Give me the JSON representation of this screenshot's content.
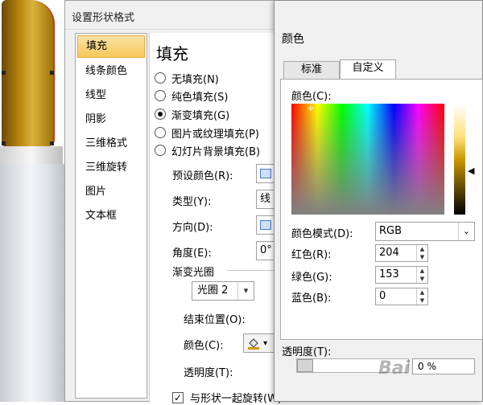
{
  "format_dialog": {
    "title": "设置形状格式",
    "help": "?",
    "sidebar": [
      "填充",
      "线条颜色",
      "线型",
      "阴影",
      "三维格式",
      "三维旋转",
      "图片",
      "文本框"
    ],
    "content_title": "填充",
    "fill_options": [
      "无填充(N)",
      "纯色填充(S)",
      "渐变填充(G)",
      "图片或纹理填充(P)",
      "幻灯片背景填充(B)"
    ],
    "selected_fill": 2,
    "preset_label": "预设颜色(R):",
    "type_label": "类型(Y):",
    "type_value": "线",
    "direction_label": "方向(D):",
    "angle_label": "角度(E):",
    "angle_value": "0°",
    "stops_label": "渐变光圈",
    "stop_value": "光圈 2",
    "end_pos_label": "结束位置(O):",
    "color_label": "颜色(C):",
    "transparency_label": "透明度(T):",
    "rotate_label": "与形状一起旋转(W)"
  },
  "color_dialog": {
    "title": "颜色",
    "tabs": [
      "标准",
      "自定义"
    ],
    "active_tab": 1,
    "colors_label": "颜色(C):",
    "model_label": "颜色模式(D):",
    "model_value": "RGB",
    "red_label": "红色(R):",
    "red_value": "204",
    "green_label": "绿色(G):",
    "green_value": "153",
    "blue_label": "蓝色(B):",
    "blue_value": "0",
    "transparency_label": "透明度(T):",
    "transparency_value": "0 %",
    "selected_color": "#cc9900"
  },
  "watermark": "Bai"
}
